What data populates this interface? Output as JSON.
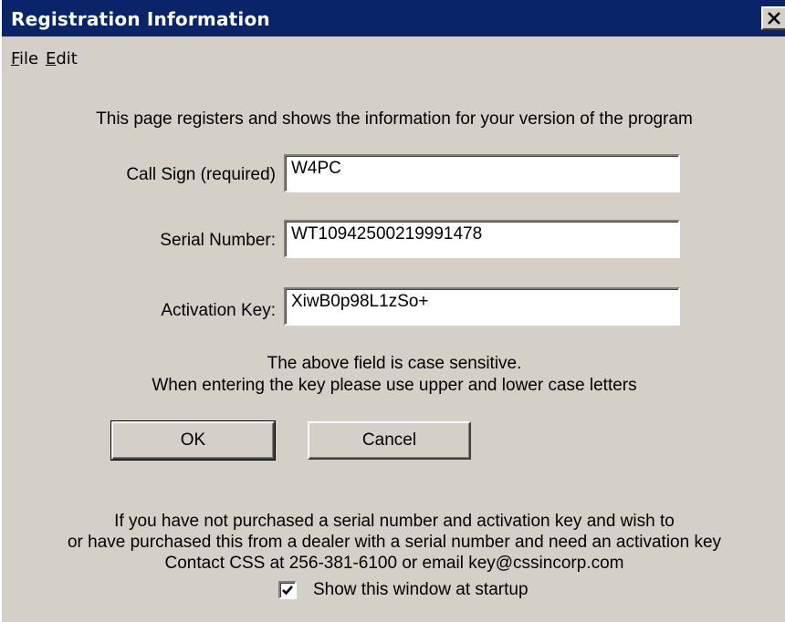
{
  "window": {
    "title": "Registration Information",
    "close_icon": "close-x-icon"
  },
  "menu": {
    "items": [
      {
        "label": "File",
        "mnemonic": "F"
      },
      {
        "label": "Edit",
        "mnemonic": "E"
      }
    ]
  },
  "intro_text": "This page registers and shows the information for your version of the program",
  "fields": {
    "call_sign": {
      "label": "Call Sign (required)",
      "value": "W4PC"
    },
    "serial_number": {
      "label": "Serial Number:",
      "value": "WT10942500219991478"
    },
    "activation_key": {
      "label": "Activation Key:",
      "value": "XiwB0p98L1zSo+"
    }
  },
  "notes": {
    "line1": "The above field is case sensitive.",
    "line2": "When entering the key please use upper and lower case letters"
  },
  "buttons": {
    "ok": "OK",
    "cancel": "Cancel"
  },
  "footer": {
    "line1": "If you have not purchased a serial number and activation key  and wish to",
    "line2": "or have purchased this from a dealer with a serial number and need an activation key",
    "line3": "Contact CSS at 256-381-6100  or email key@cssincorp.com"
  },
  "startup": {
    "label": "Show this window at startup",
    "checked": true
  },
  "colors": {
    "title_bar": "#0a246a",
    "face": "#d4d0c8"
  }
}
